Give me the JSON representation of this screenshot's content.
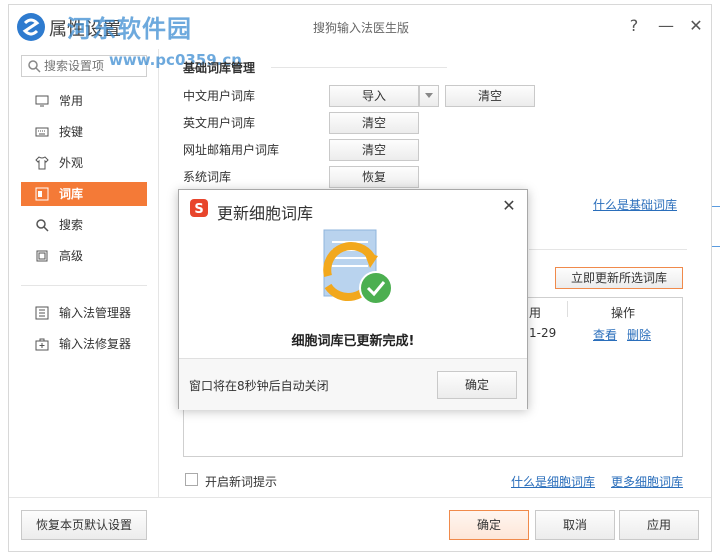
{
  "window": {
    "title": "属性设置",
    "product_name": "搜狗输入法医生版",
    "watermark": "河东软件园",
    "watermark_url": "www.pc0359.cn",
    "help": "?",
    "minimize": "—",
    "close": "✕"
  },
  "sidebar": {
    "search_placeholder": "搜索设置项",
    "items": [
      {
        "label": "常用",
        "icon": "monitor-icon"
      },
      {
        "label": "按键",
        "icon": "keyboard-icon"
      },
      {
        "label": "外观",
        "icon": "shirt-icon"
      },
      {
        "label": "词库",
        "icon": "book-icon",
        "active": true
      },
      {
        "label": "搜索",
        "icon": "search-icon"
      },
      {
        "label": "高级",
        "icon": "square-icon"
      }
    ],
    "tools": [
      {
        "label": "输入法管理器",
        "icon": "list-icon"
      },
      {
        "label": "输入法修复器",
        "icon": "repair-icon"
      }
    ]
  },
  "content": {
    "section_title": "基础词库管理",
    "rows": [
      {
        "label": "中文用户词库",
        "button1": "导入",
        "button2": "清空"
      },
      {
        "label": "英文用户词库",
        "button1": "清空"
      },
      {
        "label": "网址邮箱用户词库",
        "button1": "清空"
      },
      {
        "label": "系统词库",
        "button1": "恢复"
      }
    ],
    "what_is_basic": "什么是基础词库",
    "update_selected": "立即更新所选词库",
    "table": {
      "headers": [
        "用",
        "操作"
      ],
      "row": {
        "date": "1-29",
        "view": "查看",
        "delete": "删除"
      }
    },
    "checkbox_label": "开启新词提示",
    "what_is_cell": "什么是细胞词库",
    "more_cell": "更多细胞词库"
  },
  "footer": {
    "restore": "恢复本页默认设置",
    "ok": "确定",
    "cancel": "取消",
    "apply": "应用"
  },
  "dialog": {
    "title": "更新细胞词库",
    "message": "细胞词库已更新完成!",
    "footer_text": "窗口将在8秒钟后自动关闭",
    "ok": "确定",
    "close": "✕"
  },
  "colors": {
    "accent": "#f47a37",
    "link": "#2a6ebb",
    "watermark": "#3c8cd2"
  }
}
